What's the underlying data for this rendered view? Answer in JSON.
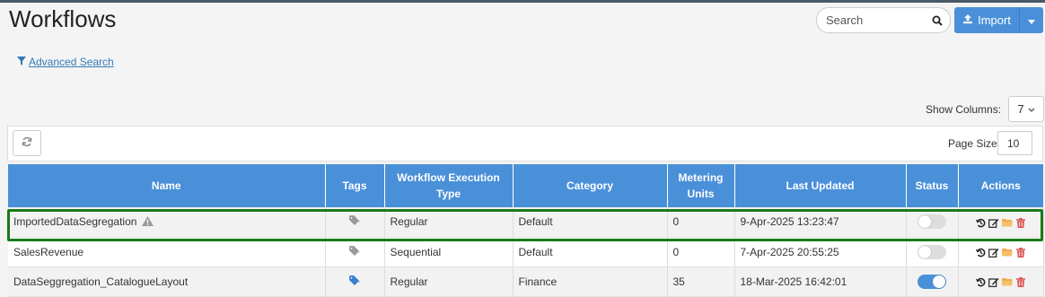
{
  "page": {
    "title": "Workflows"
  },
  "search": {
    "placeholder": "Search",
    "icon": "search-icon"
  },
  "import": {
    "label": "Import",
    "icon": "upload-icon",
    "color": "#4a90d9"
  },
  "advanced_search": {
    "label": " Advanced Search",
    "icon": "filter-icon"
  },
  "show_columns": {
    "label": "Show Columns:",
    "value": "7"
  },
  "toolbar": {
    "page_size_label": "Page Size",
    "page_size_value": "10"
  },
  "table": {
    "headers": {
      "name": "Name",
      "tags": "Tags",
      "exec_type": "Workflow Execution Type",
      "category": "Category",
      "metering_units": "Metering Units",
      "last_updated": "Last Updated",
      "status": "Status",
      "actions": "Actions"
    },
    "rows": [
      {
        "name": "ImportedDataSegregation",
        "warning": true,
        "tag_color": "#999999",
        "exec_type": "Regular",
        "category": "Default",
        "metering_units": "0",
        "last_updated": "9-Apr-2025 13:23:47",
        "status_on": false,
        "selected": true
      },
      {
        "name": "SalesRevenue",
        "warning": false,
        "tag_color": "#999999",
        "exec_type": "Sequential",
        "category": "Default",
        "metering_units": "0",
        "last_updated": "7-Apr-2025 20:55:25",
        "status_on": false,
        "selected": false
      },
      {
        "name": "DataSeggregation_CatalogueLayout",
        "warning": false,
        "tag_color": "#3a7fd0",
        "exec_type": "Regular",
        "category": "Finance",
        "metering_units": "35",
        "last_updated": "18-Mar-2025 16:42:01",
        "status_on": true,
        "selected": false
      }
    ]
  },
  "colors": {
    "header_bg": "#4a90d9",
    "highlight": "#1a7a1a",
    "delete": "#d9534f",
    "folder": "#f0ad4e"
  }
}
